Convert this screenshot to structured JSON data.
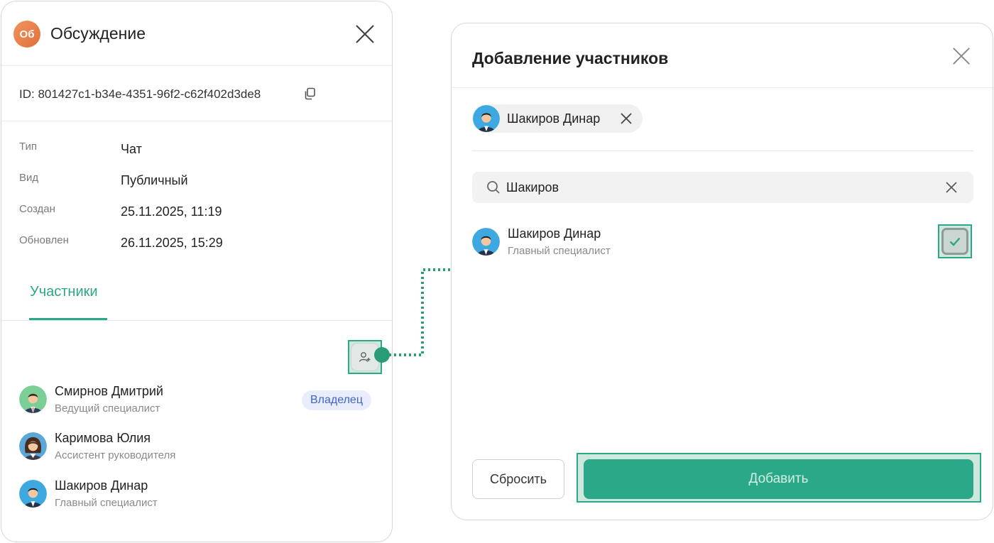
{
  "discussion_panel": {
    "avatar_initials": "Об",
    "title": "Обсуждение",
    "id_text": "ID: 801427c1-b34e-4351-96f2-c62f402d3de8",
    "properties": [
      {
        "label": "Тип",
        "value": "Чат"
      },
      {
        "label": "Вид",
        "value": "Публичный"
      },
      {
        "label": "Создан",
        "value": "25.11.2025, 11:19"
      },
      {
        "label": "Обновлен",
        "value": "26.11.2025, 15:29"
      }
    ],
    "tab_label": "Участники",
    "owner_badge": "Владелец",
    "members": [
      {
        "name": "Смирнов Дмитрий",
        "role": "Ведущий специалист"
      },
      {
        "name": "Каримова Юлия",
        "role": "Ассистент руководителя"
      },
      {
        "name": "Шакиров Динар",
        "role": "Главный специалист"
      }
    ]
  },
  "add_members_dialog": {
    "title": "Добавление участников",
    "selected_chip": "Шакиров Динар",
    "search": {
      "value": "Шакиров"
    },
    "result": {
      "name": "Шакиров Динар",
      "role": "Главный специалист",
      "checked": true
    },
    "reset_label": "Сбросить",
    "add_label": "Добавить"
  },
  "colors": {
    "accent": "#2aa888",
    "owner_badge_text": "#3e64c9",
    "avatar_orange": "#e2703a"
  }
}
